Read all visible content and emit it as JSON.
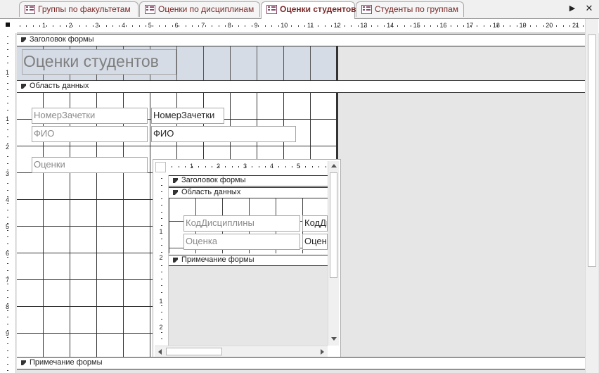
{
  "tabs": [
    {
      "label": "Группы по факультетам",
      "active": false
    },
    {
      "label": "Оценки по дисциплинам",
      "active": false
    },
    {
      "label": "Оценки студентов",
      "active": true
    },
    {
      "label": "Студенты по группам",
      "active": false
    }
  ],
  "tab_nav": {
    "next": "▶",
    "close": "✕"
  },
  "main_form": {
    "ruler_numbers": [
      "1",
      "2",
      "3",
      "4",
      "5",
      "6",
      "7",
      "8",
      "9",
      "10",
      "11",
      "12",
      "13",
      "14",
      "15",
      "16",
      "17",
      "18",
      "19",
      "20",
      "21"
    ],
    "vruler_numbers": [
      "1",
      "1",
      "2",
      "3",
      "4",
      "5",
      "6",
      "7",
      "8",
      "9"
    ],
    "sections": {
      "header": "Заголовок формы",
      "detail": "Область данных",
      "footer": "Примечание формы"
    },
    "title": "Оценки студентов",
    "controls": {
      "zach_label": "НомерЗачетки",
      "zach_field": "НомерЗачетки",
      "fio_label": "ФИО",
      "fio_field": "ФИО",
      "grades_label": "Оценки"
    }
  },
  "subform": {
    "ruler_numbers": [
      "1",
      "2",
      "3",
      "4",
      "5"
    ],
    "vruler_numbers": [
      "1",
      "2",
      "1",
      "2"
    ],
    "sections": {
      "header": "Заголовок формы",
      "detail": "Область данных",
      "footer": "Примечание формы"
    },
    "controls": {
      "disc_label": "КодДисциплины",
      "disc_field": "КодДисциплины",
      "grade_label": "Оценка",
      "grade_field": "Оценка"
    }
  },
  "colors": {
    "tab_text": "#7a2a2a",
    "header_band": "#d6dce6",
    "canvas_back": "#e6e6e6"
  }
}
